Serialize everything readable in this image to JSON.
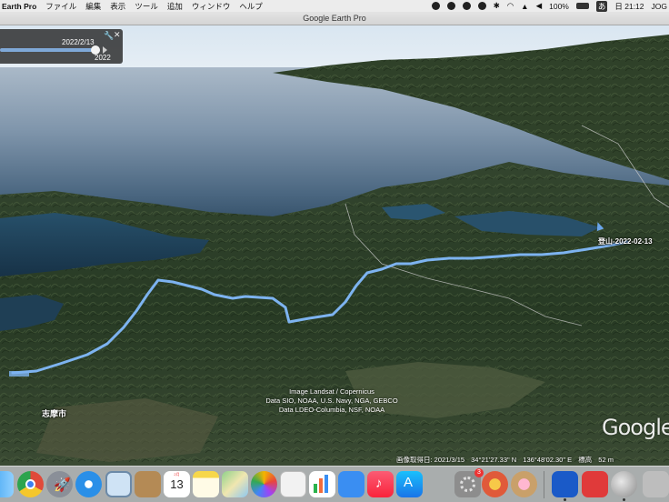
{
  "menubar": {
    "app_name": "Earth Pro",
    "items": [
      "ファイル",
      "編集",
      "表示",
      "ツール",
      "追加",
      "ウィンドウ",
      "ヘルプ"
    ],
    "battery": "100%",
    "input_method": "あ",
    "clock": "日 21:12",
    "user": "JOG"
  },
  "window": {
    "title": "Google Earth Pro"
  },
  "time_slider": {
    "date": "2022/2/13",
    "year": "2022"
  },
  "map": {
    "placemark_label": "登山-2022-02-13",
    "city_label": "志摩市",
    "credits": [
      "Image Landsat / Copernicus",
      "Data SIO, NOAA, U.S. Navy, NGA, GEBCO",
      "Data LDEO-Columbia, NSF, NOAA"
    ],
    "logo": "Google",
    "track_color": "#7db3f0",
    "status": {
      "imagery_date": "画像取得日: 2021/3/15",
      "lat": "34°21'27.33\" N",
      "lon": "136°48'02.30\" E",
      "elev_label": "標高",
      "elev_value": "52 m"
    }
  },
  "dock": {
    "calendar_month": "2月",
    "calendar_day": "13",
    "appstore_badge": "3",
    "items": [
      "finder-icon",
      "chrome-icon",
      "launchpad-icon",
      "safari-icon",
      "preview-icon",
      "contacts-icon",
      "calendar-icon",
      "notes-icon",
      "maps-icon",
      "photos-icon",
      "textedit-icon",
      "numbers-icon",
      "keynote-icon",
      "music-icon",
      "appstore-icon",
      "system-preferences-icon",
      "pokemon-icon",
      "candy-icon",
      "screen-share-icon",
      "app-icon",
      "google-earth-pro-icon",
      "trash-icon"
    ]
  }
}
